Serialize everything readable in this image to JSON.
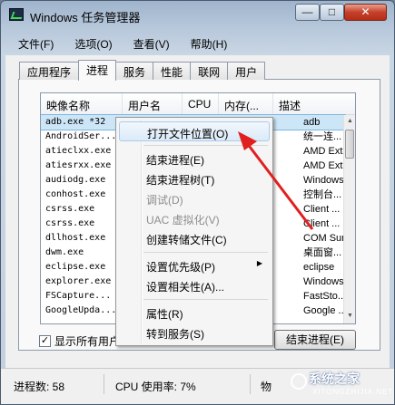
{
  "window": {
    "title": "Windows 任务管理器",
    "min_symbol": "—",
    "max_symbol": "□",
    "close_symbol": "✕"
  },
  "menubar": [
    "文件(F)",
    "选项(O)",
    "查看(V)",
    "帮助(H)"
  ],
  "tabs": [
    "应用程序",
    "进程",
    "服务",
    "性能",
    "联网",
    "用户"
  ],
  "active_tab": "进程",
  "columns": [
    "映像名称",
    "用户名",
    "CPU",
    "内存(...",
    "描述"
  ],
  "processes": [
    {
      "name": "adb.exe *32",
      "desc": "adb",
      "selected": true
    },
    {
      "name": "AndroidSer...",
      "desc": "统一连..."
    },
    {
      "name": "atieclxx.exe",
      "desc": "AMD Ext..."
    },
    {
      "name": "atiesrxx.exe",
      "desc": "AMD Ext..."
    },
    {
      "name": "audiodg.exe",
      "desc": "Windows..."
    },
    {
      "name": "conhost.exe",
      "desc": "控制台..."
    },
    {
      "name": "csrss.exe",
      "desc": "Client ..."
    },
    {
      "name": "csrss.exe",
      "desc": "Client ..."
    },
    {
      "name": "dllhost.exe",
      "desc": "COM Sur..."
    },
    {
      "name": "dwm.exe",
      "desc": "桌面窗..."
    },
    {
      "name": "eclipse.exe",
      "desc": "eclipse"
    },
    {
      "name": "explorer.exe",
      "desc": "Windows..."
    },
    {
      "name": "FSCapture...",
      "desc": "FastSto..."
    },
    {
      "name": "GoogleUpda...",
      "desc": "Google ..."
    }
  ],
  "show_all_users_label": "显示所有用户",
  "end_process_button": "结束进程(E)",
  "status": {
    "process_count": "进程数: 58",
    "cpu_usage": "CPU 使用率: 7%",
    "memory_partial": "物"
  },
  "context_menu": {
    "items": [
      {
        "label": "打开文件位置(O)",
        "highlighted": true
      },
      {
        "label": "结束进程(E)"
      },
      {
        "label": "结束进程树(T)"
      },
      {
        "label": "调试(D)",
        "disabled": true
      },
      {
        "label": "UAC 虚拟化(V)",
        "disabled": true
      },
      {
        "label": "创建转储文件(C)"
      },
      {
        "label": "设置优先级(P)",
        "submenu": true
      },
      {
        "label": "设置相关性(A)..."
      },
      {
        "label": "属性(R)"
      },
      {
        "label": "转到服务(S)"
      }
    ]
  },
  "watermark": {
    "text": "系统之家",
    "sub": "XITONGZHIJIA.NET"
  },
  "colors": {
    "annotation_arrow": "#e0201e",
    "selection": "#cde6f7",
    "menu_highlight": "#dbeaf8"
  }
}
